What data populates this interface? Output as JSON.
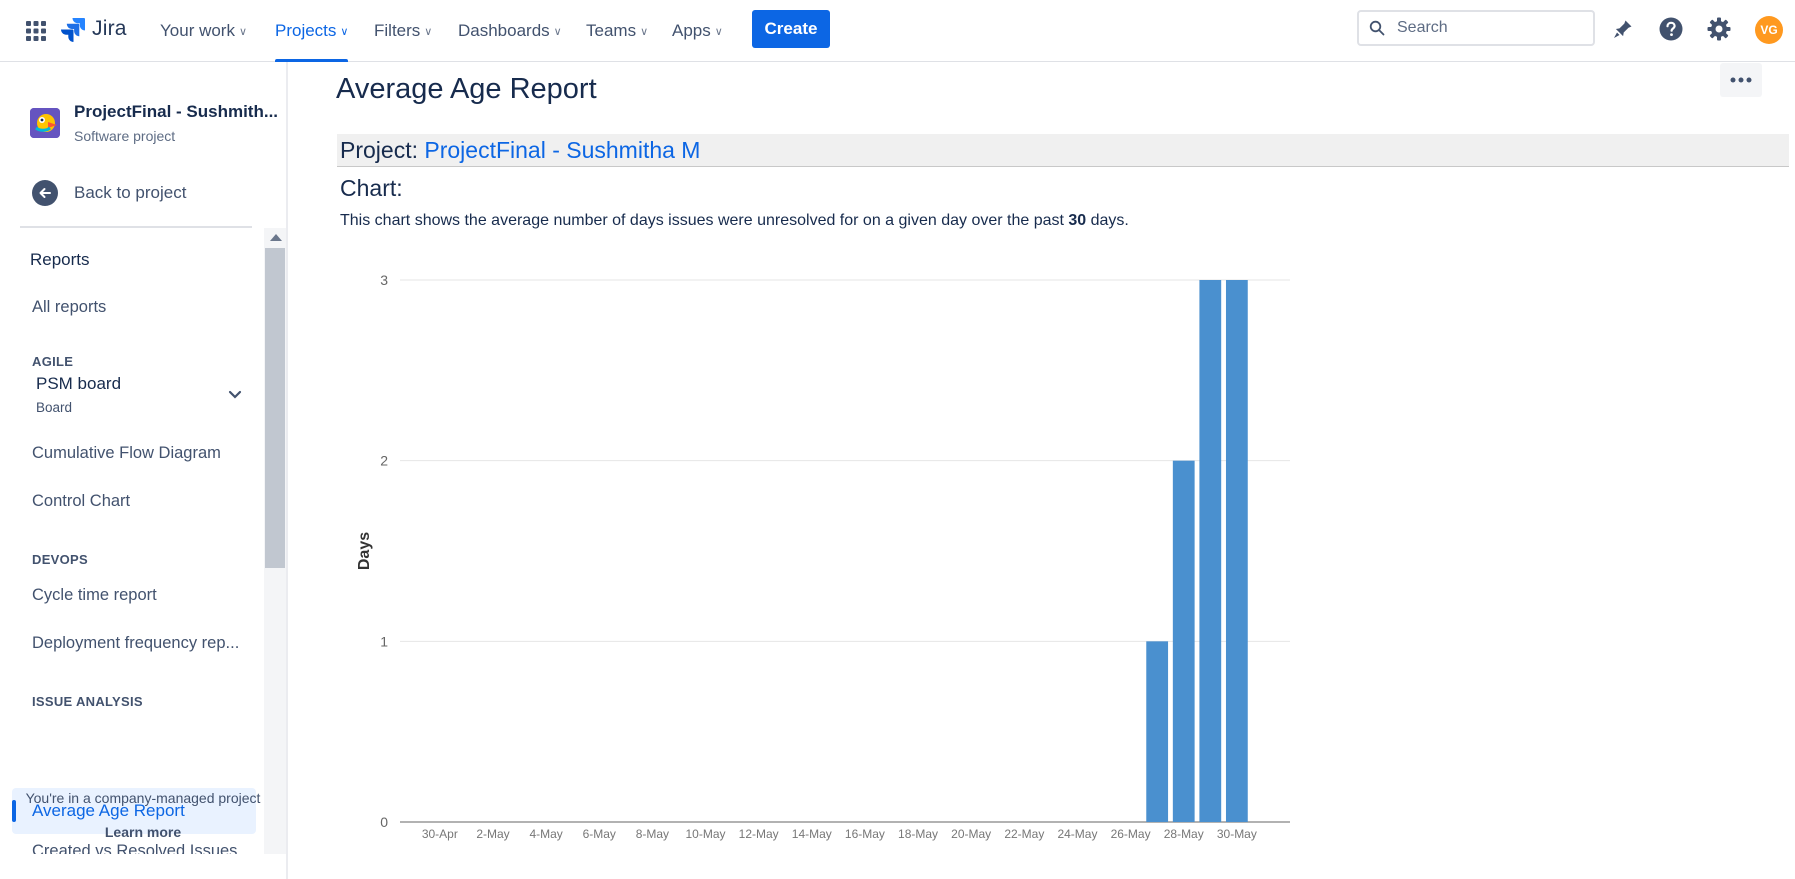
{
  "nav": {
    "logo": "Jira",
    "items": [
      {
        "label": "Your work"
      },
      {
        "label": "Projects"
      },
      {
        "label": "Filters"
      },
      {
        "label": "Dashboards"
      },
      {
        "label": "Teams"
      },
      {
        "label": "Apps"
      }
    ],
    "active": "Projects",
    "create_label": "Create",
    "search_placeholder": "Search",
    "avatar_initials": "VG",
    "avatar_color": "#ff991f"
  },
  "sidebar": {
    "project_name": "ProjectFinal - Sushmith...",
    "project_type": "Software project",
    "back_label": "Back to project",
    "reports_label": "Reports",
    "all_reports": "All reports",
    "agile_heading": "AGILE",
    "board_name": "PSM board",
    "board_type": "Board",
    "cfd": "Cumulative Flow Diagram",
    "control_chart": "Control Chart",
    "devops_heading": "DEVOPS",
    "cycle_time": "Cycle time report",
    "deployment": "Deployment frequency rep...",
    "issue_heading": "ISSUE ANALYSIS",
    "active_item": "Average Age Report",
    "partial_item": "Created vs Resolved Issues",
    "footer_text": "You're in a company-managed project",
    "learn_more": "Learn more"
  },
  "main": {
    "title": "Average Age Report",
    "project_prefix": "Project:",
    "project_link": "ProjectFinal - Sushmitha M",
    "chart_heading": "Chart:",
    "desc_before": "This chart shows the average number of days issues were unresolved for on a given day over the past ",
    "desc_days": "30",
    "desc_after": " days."
  },
  "chart_data": {
    "type": "bar",
    "ylabel": "Days",
    "ylim": [
      0,
      3
    ],
    "yticks": [
      0,
      1,
      2,
      3
    ],
    "bar_color": "#4a90cf",
    "x_tick_labels": [
      "30-Apr",
      "2-May",
      "4-May",
      "6-May",
      "8-May",
      "10-May",
      "12-May",
      "14-May",
      "16-May",
      "18-May",
      "20-May",
      "22-May",
      "24-May",
      "26-May",
      "28-May",
      "30-May"
    ],
    "categories": [
      "30-Apr",
      "1-May",
      "2-May",
      "3-May",
      "4-May",
      "5-May",
      "6-May",
      "7-May",
      "8-May",
      "9-May",
      "10-May",
      "11-May",
      "12-May",
      "13-May",
      "14-May",
      "15-May",
      "16-May",
      "17-May",
      "18-May",
      "19-May",
      "20-May",
      "21-May",
      "22-May",
      "23-May",
      "24-May",
      "25-May",
      "26-May",
      "27-May",
      "28-May",
      "29-May",
      "30-May"
    ],
    "values": [
      0,
      0,
      0,
      0,
      0,
      0,
      0,
      0,
      0,
      0,
      0,
      0,
      0,
      0,
      0,
      0,
      0,
      0,
      0,
      0,
      0,
      0,
      0,
      0,
      0,
      0,
      0,
      1,
      2,
      3,
      3
    ]
  }
}
